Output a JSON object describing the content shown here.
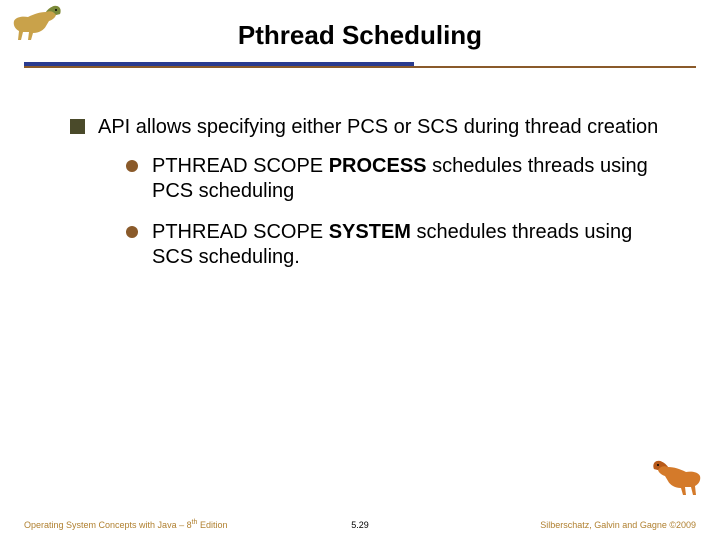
{
  "header": {
    "title": "Pthread Scheduling"
  },
  "body": {
    "main_point": "API allows specifying either PCS or SCS during thread creation",
    "sub_points": [
      {
        "prefix": "PTHREAD SCOPE ",
        "bold": "PROCESS",
        "suffix": " schedules threads using PCS scheduling"
      },
      {
        "prefix": "PTHREAD SCOPE ",
        "bold": "SYSTEM",
        "suffix": " schedules threads using SCS scheduling."
      }
    ]
  },
  "footer": {
    "left_prefix": "Operating System Concepts with Java – 8",
    "left_super": "th",
    "left_suffix": " Edition",
    "center": "5.29",
    "right": "Silberschatz, Galvin and Gagne ©2009"
  },
  "icons": {
    "dino_top": "dinosaur-icon",
    "dino_bottom": "dinosaur-icon"
  }
}
